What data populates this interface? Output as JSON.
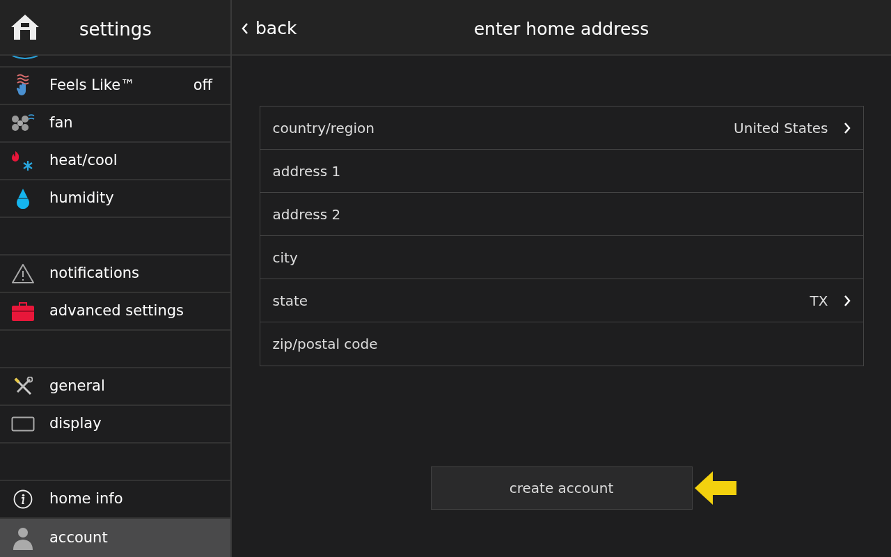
{
  "sidebar": {
    "title": "settings",
    "items": [
      {
        "kind": "item",
        "label": "Feels Like™",
        "value": "off",
        "selected": false
      },
      {
        "kind": "item",
        "label": "fan",
        "selected": false
      },
      {
        "kind": "item",
        "label": "heat/cool",
        "selected": false
      },
      {
        "kind": "item",
        "label": "humidity",
        "selected": false
      },
      {
        "kind": "spacer"
      },
      {
        "kind": "item",
        "label": "notifications",
        "selected": false
      },
      {
        "kind": "item",
        "label": "advanced settings",
        "selected": false
      },
      {
        "kind": "spacer"
      },
      {
        "kind": "item",
        "label": "general",
        "selected": false
      },
      {
        "kind": "item",
        "label": "display",
        "selected": false
      },
      {
        "kind": "spacer"
      },
      {
        "kind": "item",
        "label": "home info",
        "selected": false
      },
      {
        "kind": "item",
        "label": "account",
        "selected": true
      }
    ]
  },
  "header": {
    "back": "back",
    "title": "enter home address"
  },
  "form": [
    {
      "kind": "select",
      "label": "country/region",
      "value": "United States"
    },
    {
      "kind": "text",
      "placeholder": "address 1"
    },
    {
      "kind": "text",
      "placeholder": "address 2"
    },
    {
      "kind": "text",
      "placeholder": "city"
    },
    {
      "kind": "select",
      "label": "state",
      "value": "TX"
    },
    {
      "kind": "text",
      "placeholder": "zip/postal code"
    }
  ],
  "button": "create account"
}
